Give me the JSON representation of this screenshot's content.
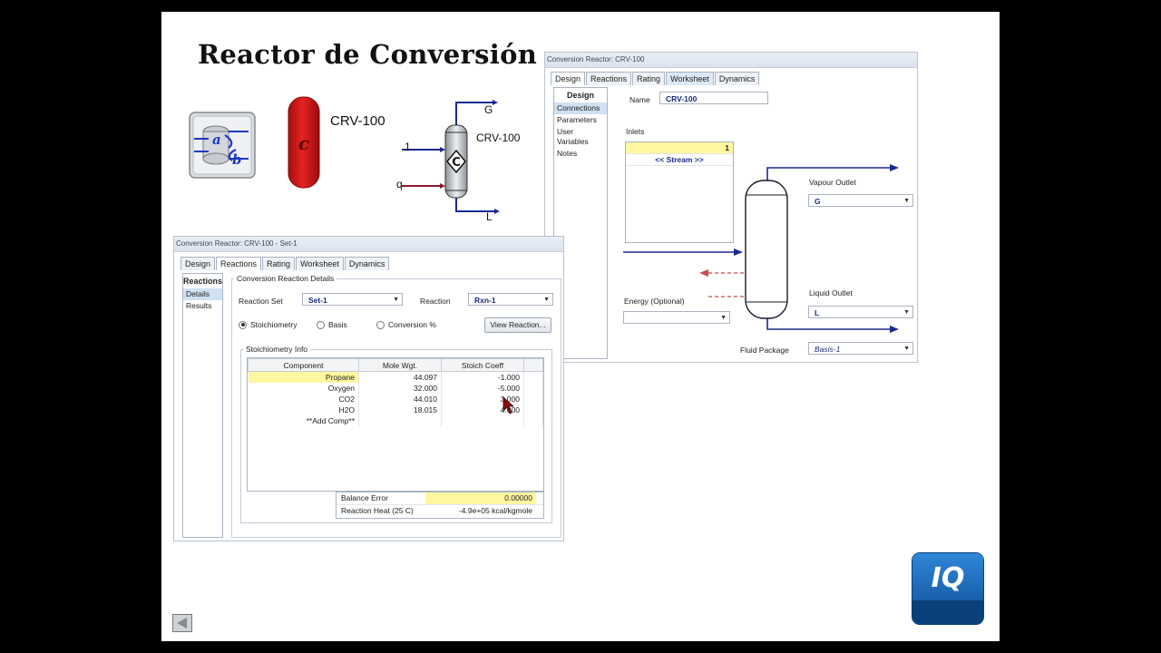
{
  "slide": {
    "title": "Reactor de Conversión",
    "label_crv_1": "CRV-100",
    "label_crv_2": "CRV-100",
    "stream_G": "G",
    "stream_1": "1",
    "stream_q": "q",
    "stream_L": "L",
    "icon_letter_a": "a",
    "icon_letter_b": "b",
    "vessel_letter": "c",
    "pfd_letter": "C",
    "logo": "IQ"
  },
  "win_design": {
    "title": "Conversion Reactor: CRV-100",
    "tabs": [
      "Design",
      "Reactions",
      "Rating",
      "Worksheet",
      "Dynamics"
    ],
    "nav_head": "Design",
    "nav_items": [
      "Connections",
      "Parameters",
      "User Variables",
      "Notes"
    ],
    "name_label": "Name",
    "name_value": "CRV-100",
    "inlets_label": "Inlets",
    "inlet_value": "1",
    "inlet_stream": "<< Stream >>",
    "vapour_label": "Vapour Outlet",
    "vapour_value": "G",
    "energy_label": "Energy (Optional)",
    "energy_value": "",
    "liquid_label": "Liquid Outlet",
    "liquid_value": "L",
    "fluid_label": "Fluid Package",
    "fluid_value": "Basis-1"
  },
  "win_reactions": {
    "title": "Conversion Reactor: CRV-100 - Set-1",
    "tabs": [
      "Design",
      "Reactions",
      "Rating",
      "Worksheet",
      "Dynamics"
    ],
    "nav_head": "Reactions",
    "nav_items": [
      "Details",
      "Results"
    ],
    "group_title": "Conversion Reaction Details",
    "reaction_set_label": "Reaction Set",
    "reaction_set_value": "Set-1",
    "reaction_label": "Reaction",
    "reaction_value": "Rxn-1",
    "radio_stoich": "Stoichiometry",
    "radio_basis": "Basis",
    "radio_conversion": "Conversion %",
    "view_button": "View Reaction...",
    "stoich_title": "Stoichiometry Info",
    "columns": [
      "Component",
      "Mole Wgt.",
      "Stoich Coeff"
    ],
    "rows": [
      {
        "component": "Propane",
        "mw": "44.097",
        "coeff": "-1.000"
      },
      {
        "component": "Oxygen",
        "mw": "32.000",
        "coeff": "-5.000"
      },
      {
        "component": "CO2",
        "mw": "44.010",
        "coeff": "3.000"
      },
      {
        "component": "H2O",
        "mw": "18.015",
        "coeff": "4.000"
      },
      {
        "component": "**Add Comp**",
        "mw": "",
        "coeff": ""
      }
    ],
    "balance_error_label": "Balance Error",
    "balance_error_value": "0.00000",
    "reaction_heat_label": "Reaction Heat (25 C)",
    "reaction_heat_value": "-4.9e+05 kcal/kgmole"
  },
  "colors": {
    "accent": "#1a2b8f",
    "vessel_red": "#d81c1c",
    "logo_blue": "#1565b8",
    "highlight": "#fff7a0"
  }
}
